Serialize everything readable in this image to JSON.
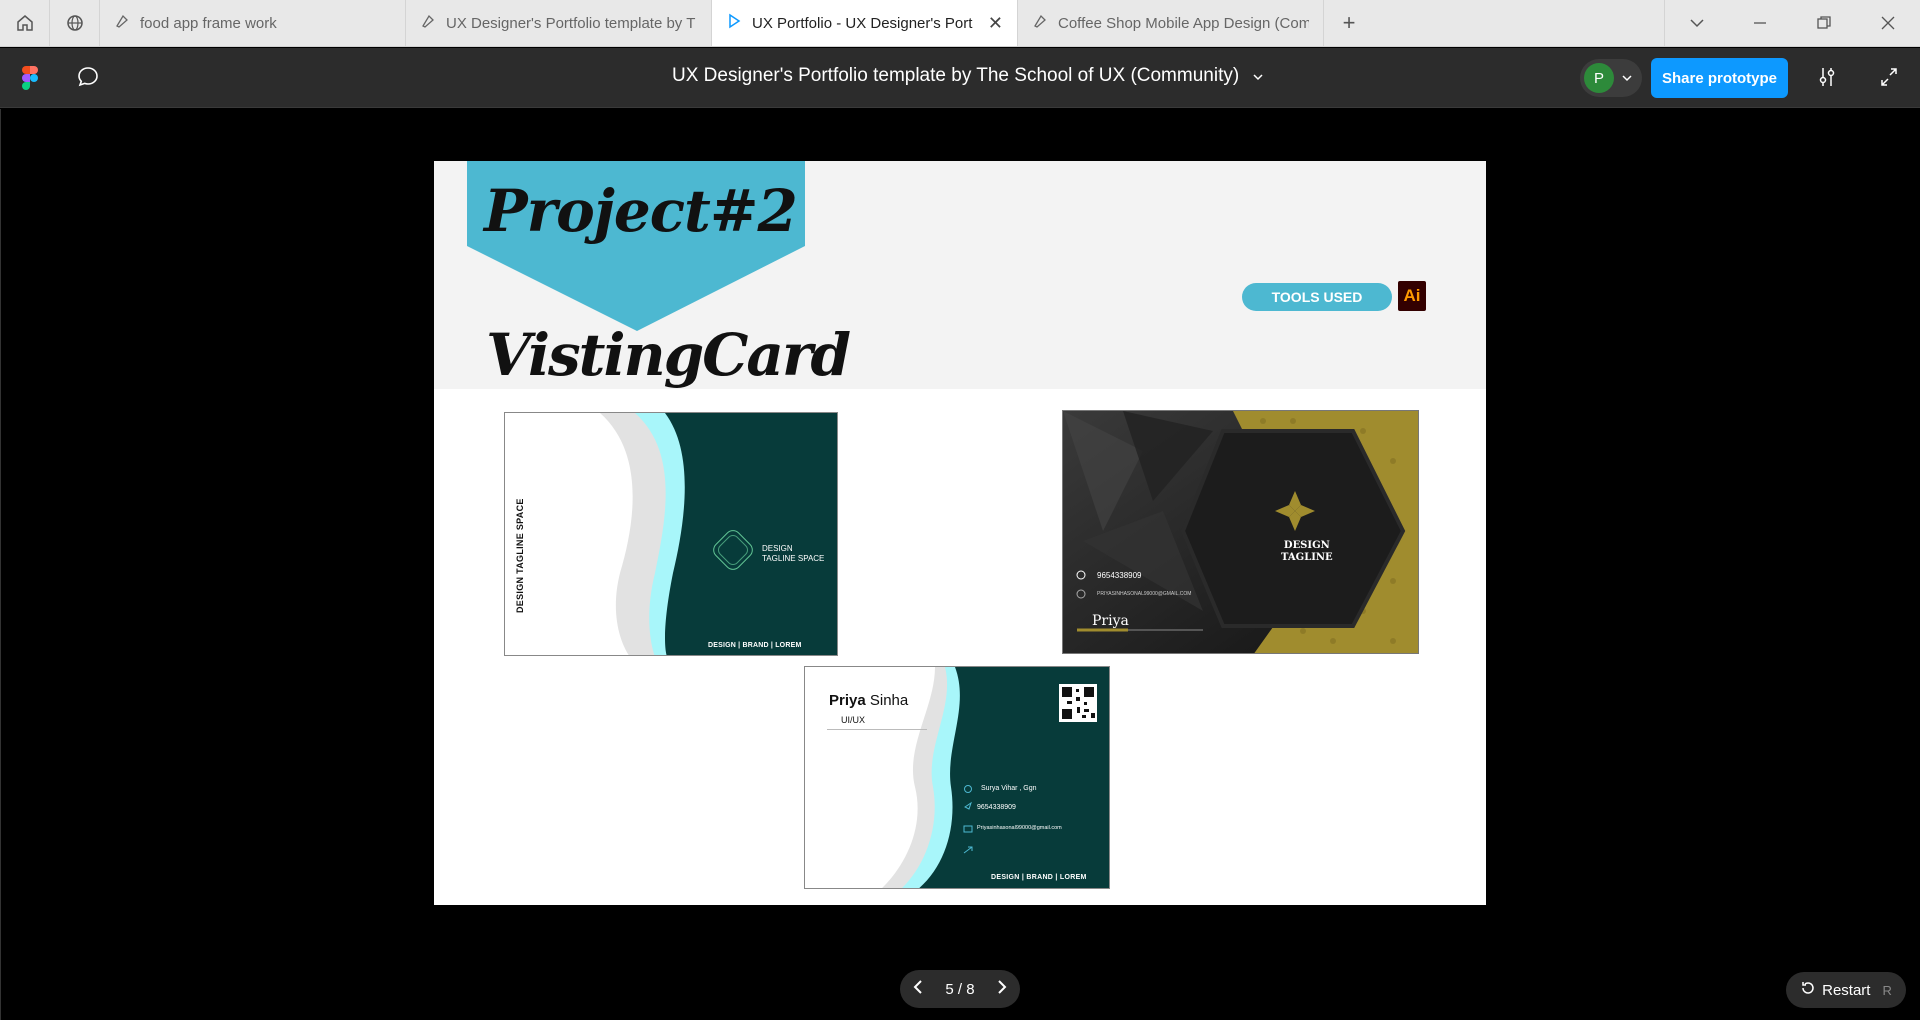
{
  "browser": {
    "tabs": [
      {
        "label": "food app frame work",
        "active": false
      },
      {
        "label": "UX Designer's Portfolio template by T",
        "active": false
      },
      {
        "label": "UX Portfolio - UX Designer's Port",
        "active": true
      },
      {
        "label": "Coffee Shop Mobile App Design (Com",
        "active": false
      }
    ]
  },
  "toolbar": {
    "doc_title": "UX Designer's Portfolio template by The School of UX (Community)",
    "avatar_initial": "P",
    "share_label": "Share prototype"
  },
  "slide": {
    "project_title": "Project#2",
    "card_title": "VistingCard",
    "tools_label": "TOOLS USED",
    "tool_badge": "Ai",
    "card1": {
      "vertical_tagline": "DESIGN TAGLINE SPACE",
      "logo_tagline_1": "DESIGN",
      "logo_tagline_2": "TAGLINE SPACE",
      "footer": "DESIGN | BRAND | LOREM"
    },
    "card2": {
      "phone": "9654338909",
      "email": "PRIYASINHASONAL99000@GMAIL.COM",
      "name": "Priya",
      "tagline_1": "DESIGN",
      "tagline_2": "TAGLINE"
    },
    "card3": {
      "first_name": "Priya",
      "last_name": "Sinha",
      "role": "UI/UX",
      "address": "Surya Vihar , Ggn",
      "phone": "9654338909",
      "email": "Priyasinhasonal99000@gmail.com",
      "footer": "DESIGN | BRAND | LOREM"
    }
  },
  "pager": {
    "label": "5 / 8"
  },
  "restart": {
    "label": "Restart",
    "shortcut": "R"
  },
  "colors": {
    "accent": "#0d99ff",
    "banner": "#4db8d1",
    "card_teal": "#073b3a",
    "gold": "#a08c2e"
  }
}
